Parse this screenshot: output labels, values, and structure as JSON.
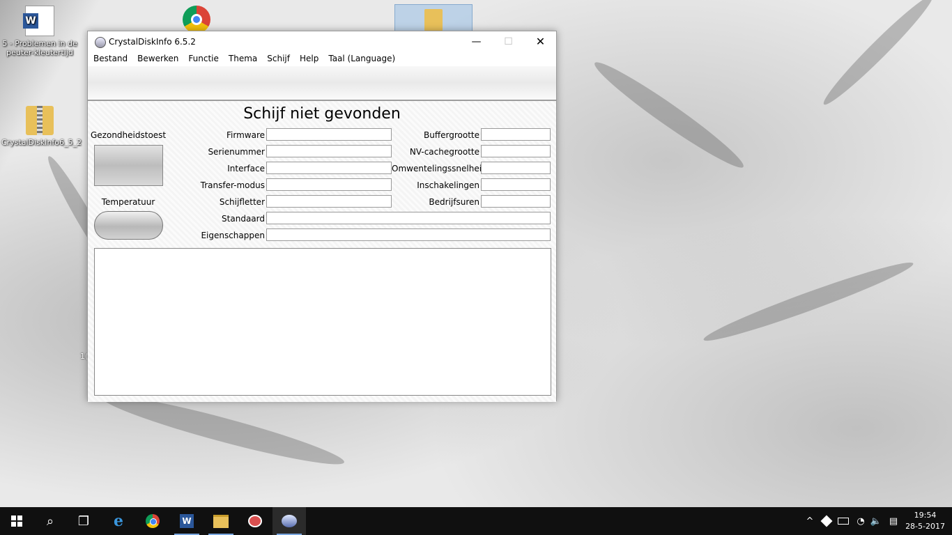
{
  "desktop": {
    "icons": [
      {
        "label": "5 - Problemen in de peuter-kleutertijd"
      },
      {
        "label": "CrystalDiskInfo6_5_2"
      }
    ],
    "stray_text": "1("
  },
  "window": {
    "title": "CrystalDiskInfo 6.5.2",
    "controls": {
      "minimize": "—",
      "maximize": "☐",
      "close": "✕"
    },
    "menu": [
      "Bestand",
      "Bewerken",
      "Functie",
      "Thema",
      "Schijf",
      "Help",
      "Taal (Language)"
    ],
    "disk_title": "Schijf niet gevonden",
    "health_label": "Gezondheidstoest",
    "temperature_label": "Temperatuur",
    "fields_left": [
      {
        "label": "Firmware",
        "value": ""
      },
      {
        "label": "Serienummer",
        "value": ""
      },
      {
        "label": "Interface",
        "value": ""
      },
      {
        "label": "Transfer-modus",
        "value": ""
      },
      {
        "label": "Schijfletter",
        "value": ""
      }
    ],
    "fields_right": [
      {
        "label": "Buffergrootte",
        "value": ""
      },
      {
        "label": "NV-cachegrootte",
        "value": ""
      },
      {
        "label": "Omwentelingssnelheid",
        "value": ""
      },
      {
        "label": "Inschakelingen",
        "value": ""
      },
      {
        "label": "Bedrijfsuren",
        "value": ""
      }
    ],
    "fields_wide": [
      {
        "label": "Standaard",
        "value": ""
      },
      {
        "label": "Eigenschappen",
        "value": ""
      }
    ]
  },
  "taskbar": {
    "search_glyph": "⌕",
    "taskview_glyph": "❐",
    "edge_glyph": "e",
    "word_glyph": "W",
    "tray": {
      "chevron": "^",
      "wifi": "◔",
      "speaker": "🔈",
      "notifications": "▤"
    },
    "clock": {
      "time": "19:54",
      "date": "28-5-2017"
    }
  },
  "colors": {
    "accent": "#2b579a",
    "taskbar": "#101010"
  }
}
